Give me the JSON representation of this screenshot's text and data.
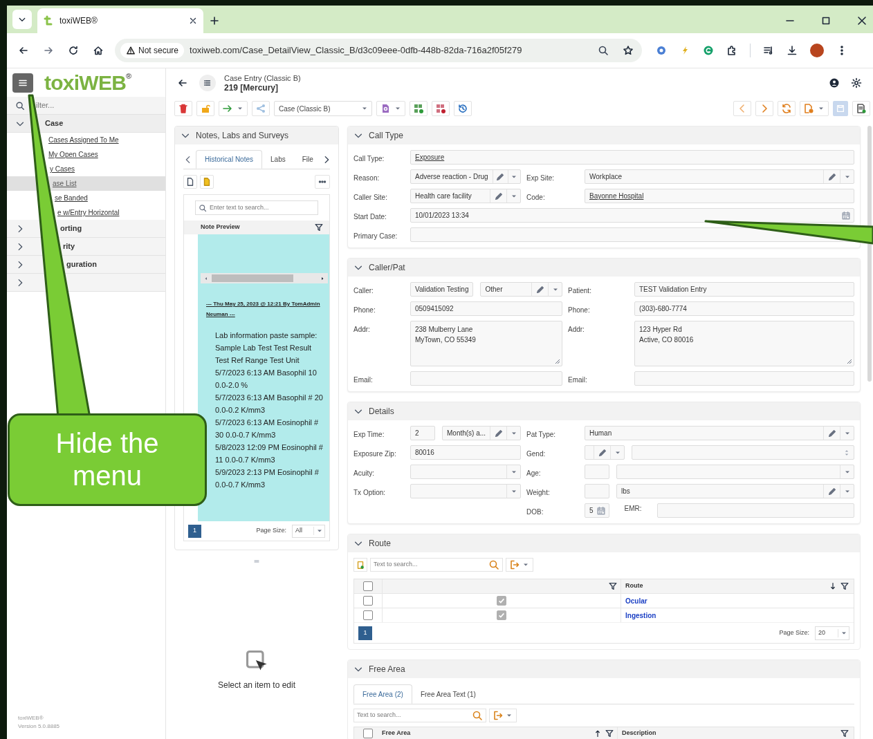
{
  "browser": {
    "tab_title": "toxiWEB®",
    "security": "Not secure",
    "url": "toxiweb.com/Case_DetailView_Classic_B/d3c09eee-0dfb-448b-82da-716a2f05f279"
  },
  "header": {
    "logo": "toxiWEB",
    "logo_mark": "®",
    "subtitle": "Case Entry (Classic B)",
    "title": "219 [Mercury]"
  },
  "sidebar": {
    "filter_placeholder": "ilter...",
    "groups": [
      {
        "label": "Case",
        "expanded": true,
        "children": [
          {
            "label": "Cases Assigned To Me",
            "selected": false
          },
          {
            "label": "My Open Cases",
            "selected": false
          },
          {
            "label": "y Cases",
            "selected": false
          },
          {
            "label": "ase List",
            "selected": true
          },
          {
            "label": "se Banded",
            "selected": false
          },
          {
            "label": "e w/Entry Horizontal",
            "selected": false
          }
        ]
      },
      {
        "label": "orting",
        "expanded": false
      },
      {
        "label": "rity",
        "expanded": false
      },
      {
        "label": "guration",
        "expanded": false
      },
      {
        "expanded": false
      }
    ],
    "footer": [
      "toxiWEB®",
      "Version 5.0.8885"
    ]
  },
  "toolbar": {
    "view": "Case (Classic B)"
  },
  "notes": {
    "title": "Notes, Labs and Surveys",
    "tabs": [
      {
        "label": "Historical Notes",
        "selected": true
      },
      {
        "label": "Labs",
        "selected": false
      },
      {
        "label": "File",
        "selected": false
      }
    ],
    "search_placeholder": "Enter text to search...",
    "column": "Note Preview",
    "note_header": "--- Thu May 25, 2023 @ 12:21 By TomAdmin Neuman ---",
    "note_lines": [
      "Lab information paste sample:",
      "Sample Lab Test Test Result Test Ref Range Test Unit",
      "5/7/2023 6:13 AM Basophil 10 0.0-2.0 %",
      "5/7/2023 6:13 AM Basophil # 20 0.0-0.2 K/mm3",
      "5/7/2023 6:13 AM Eosinophil # 30 0.0-0.7 K/mm3",
      "5/8/2023 12:09 PM Eosinophil # 11 0.0-0.7 K/mm3",
      "5/9/2023 2:13 PM Eosinophil # 0.0-0.7 K/mm3"
    ],
    "page": "1",
    "page_size_label": "Page Size:",
    "page_size": "All",
    "empty_hint": "Select an item to edit"
  },
  "sections": [
    {
      "title": "Call Type",
      "rows": [
        {
          "full": {
            "label": "Call Type:",
            "parts": [
              {
                "kind": "link",
                "value": "Exposure"
              }
            ]
          }
        },
        {
          "left": {
            "label": "Reason:",
            "parts": [
              {
                "kind": "combo",
                "value": "Adverse reaction - Drug"
              }
            ]
          },
          "right": {
            "label": "Exp Site:",
            "parts": [
              {
                "kind": "combo",
                "value": "Workplace"
              }
            ]
          }
        },
        {
          "left": {
            "label": "Caller Site:",
            "parts": [
              {
                "kind": "combo",
                "value": "Health care facility"
              }
            ]
          },
          "right": {
            "label": "Code:",
            "parts": [
              {
                "kind": "link",
                "value": "Bayonne Hospital"
              }
            ]
          }
        },
        {
          "full": {
            "label": "Start Date:",
            "parts": [
              {
                "kind": "date",
                "value": "10/01/2023 13:34"
              }
            ]
          }
        },
        {
          "full": {
            "label": "Primary Case:",
            "parts": [
              {
                "kind": "text"
              }
            ]
          }
        }
      ]
    },
    {
      "title": "Caller/Pat",
      "rows": [
        {
          "left": {
            "label": "Caller:",
            "parts": [
              {
                "kind": "text",
                "value": "Validation Testing"
              },
              {
                "kind": "combo",
                "value": "Other"
              }
            ]
          },
          "right": {
            "label": "Patient:",
            "parts": [
              {
                "kind": "text",
                "value": "TEST Validation Entry"
              }
            ]
          }
        },
        {
          "left": {
            "label": "Phone:",
            "parts": [
              {
                "kind": "text",
                "value": "0509415092"
              }
            ]
          },
          "right": {
            "label": "Phone:",
            "parts": [
              {
                "kind": "text",
                "value": "(303)-680-7774"
              }
            ]
          }
        },
        {
          "left": {
            "label": "Addr:",
            "parts": [
              {
                "kind": "memo",
                "value": "238 Mulberry Lane\nMyTown, CO 55349"
              }
            ]
          },
          "right": {
            "label": "Addr:",
            "parts": [
              {
                "kind": "memo",
                "value": "123 Hyper Rd\nActive, CO 80016"
              }
            ]
          }
        },
        {
          "left": {
            "label": "Email:",
            "parts": [
              {
                "kind": "text"
              }
            ]
          },
          "right": {
            "label": "Email:",
            "parts": [
              {
                "kind": "text"
              }
            ]
          }
        }
      ]
    },
    {
      "title": "Details",
      "rows": [
        {
          "left": {
            "label": "Exp Time:",
            "parts": [
              {
                "kind": "text",
                "value": "2"
              },
              {
                "kind": "combo",
                "value": "Month(s) a..."
              }
            ]
          },
          "right": {
            "label": "Pat Type:",
            "parts": [
              {
                "kind": "combo",
                "value": "Human"
              }
            ]
          }
        },
        {
          "left": {
            "label": "Exposure Zip:",
            "parts": [
              {
                "kind": "text",
                "value": "80016"
              }
            ]
          },
          "right": {
            "label": "Gend:",
            "parts": [
              {
                "kind": "combo"
              },
              {
                "kind": "spin"
              }
            ]
          }
        },
        {
          "left": {
            "label": "Acuity:",
            "parts": [
              {
                "kind": "select"
              }
            ]
          },
          "right": {
            "label": "Age:",
            "parts": [
              {
                "kind": "text"
              },
              {
                "kind": "select"
              }
            ]
          }
        },
        {
          "left": {
            "label": "Tx Option:",
            "parts": [
              {
                "kind": "select"
              }
            ]
          },
          "right": {
            "label": "Weight:",
            "parts": [
              {
                "kind": "text"
              },
              {
                "kind": "combo",
                "value": "lbs"
              }
            ]
          }
        },
        {
          "right": {
            "label": "DOB:",
            "parts": [
              {
                "kind": "date",
                "value": "5"
              },
              {
                "kind": "label",
                "value": "EMR:"
              },
              {
                "kind": "text"
              }
            ]
          }
        }
      ]
    }
  ],
  "route": {
    "title": "Route",
    "search_placeholder": "Text to search...",
    "select_all_checked": false,
    "column": "Route",
    "rows": [
      {
        "checked": false,
        "flag": true,
        "route": "Ocular"
      },
      {
        "checked": false,
        "flag": true,
        "route": "Ingestion"
      }
    ],
    "page": "1",
    "page_size_label": "Page Size:",
    "page_size": "20"
  },
  "free_area": {
    "title": "Free Area",
    "tabs": [
      {
        "label": "Free Area (2)",
        "selected": true
      },
      {
        "label": "Free Area Text (1)",
        "selected": false
      }
    ],
    "search_placeholder": "Text to search...",
    "select_all_checked": false,
    "columns": [
      "Free Area",
      "Description"
    ]
  },
  "callout": {
    "text": "Hide the menu"
  }
}
